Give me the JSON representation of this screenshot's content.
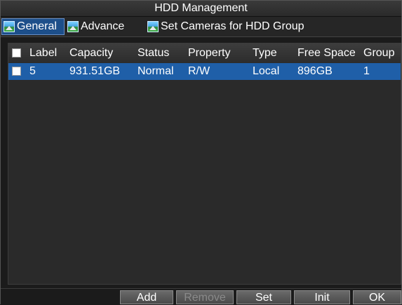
{
  "window": {
    "title": "HDD Management"
  },
  "tabs": [
    {
      "label": "General",
      "icon": "image-icon",
      "active": true
    },
    {
      "label": "Advance",
      "icon": "image-icon",
      "active": false
    },
    {
      "label": "Set Cameras for HDD Group",
      "icon": "image-icon",
      "active": false
    }
  ],
  "table": {
    "columns": [
      "Label",
      "Capacity",
      "Status",
      "Property",
      "Type",
      "Free Space",
      "Group"
    ],
    "rows": [
      {
        "label": "5",
        "capacity": "931.51GB",
        "status": "Normal",
        "property": "R/W",
        "type": "Local",
        "free_space": "896GB",
        "group": "1",
        "selected": true
      }
    ]
  },
  "buttons": {
    "add": "Add",
    "remove": "Remove",
    "set": "Set",
    "init": "Init",
    "ok": "OK"
  },
  "colors": {
    "selection": "#1f5fa8",
    "background": "#1b1b1b"
  }
}
